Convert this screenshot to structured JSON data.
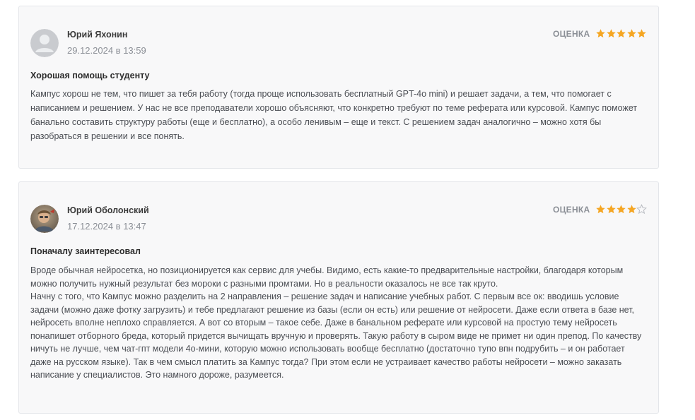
{
  "reviews": [
    {
      "author": "Юрий Яхонин",
      "date": "29.12.2024 в 13:59",
      "rating_label": "ОЦЕНКА",
      "rating": 5,
      "rating_max": 5,
      "avatar": "default-user-icon",
      "title": "Хорошая помощь студенту",
      "paragraphs": [
        "Кампус хорош не тем, что пишет за тебя работу (тогда проще использовать бесплатный GPT-4o mini) и решает задачи, а тем, что помогает с написанием и решением. У нас не все преподаватели хорошо объясняют, что конкретно требуют по теме реферата или курсовой. Кампус поможет банально составить структуру работы (еще и бесплатно), а особо ленивым – еще и текст. С решением задач аналогично – можно хотя бы разобраться в решении и все понять."
      ]
    },
    {
      "author": "Юрий Оболонский",
      "date": "17.12.2024 в 13:47",
      "rating_label": "ОЦЕНКА",
      "rating": 4,
      "rating_max": 5,
      "avatar": "user-photo",
      "title": "Поначалу заинтересовал",
      "paragraphs": [
        "Вроде обычная нейросетка, но позиционируется как сервис для учебы. Видимо, есть какие-то предварительные настройки, благодаря которым можно получить нужный результат без мороки с разными промтами. Но в реальности оказалось не все так круто.",
        "Начну с того, что Кампус можно разделить на 2 направления – решение задач и написание учебных работ. С первым все ок: вводишь условие задачи (можно даже фотку загрузить) и тебе предлагают решение из базы (если он есть) или решение от нейросети. Даже если ответа в базе нет, нейросеть вполне неплохо справляется. А вот со вторым – такое себе. Даже в банальном реферате или курсовой на простую тему нейросеть понапишет отборного бреда, который придется вычищать вручную и проверять. Такую работу в сыром виде не примет ни один препод. По качеству ничуть не лучше, чем чат-гпт модели 4о-мини, которую можно использовать вообще бесплатно (достаточно тупо впн подрубить – и он работает даже на русском языке). Так в чем смысл платить за Кампус тогда? При этом если не устраивает качество работы нейросети – можно заказать написание у специалистов. Это намного дороже, разумеется."
      ]
    }
  ],
  "colors": {
    "star_filled": "#f5a623",
    "star_empty": "#b9bcc2",
    "card_bg": "#f8f8f9",
    "card_border": "#e4e6ea"
  }
}
